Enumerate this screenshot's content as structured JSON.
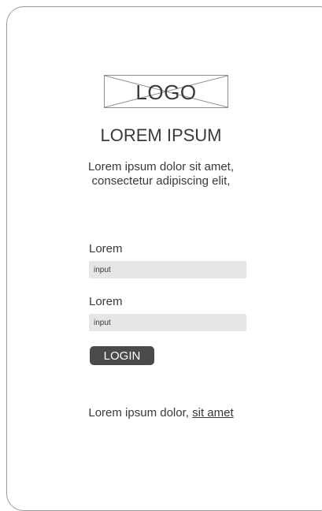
{
  "logo": {
    "text": "LOGO"
  },
  "header": {
    "title": "LOREM IPSUM",
    "subtitle_line1": "Lorem ipsum dolor sit amet,",
    "subtitle_line2": "consectetur adipiscing elit,"
  },
  "form": {
    "field1": {
      "label": "Lorem",
      "placeholder": "input"
    },
    "field2": {
      "label": "Lorem",
      "placeholder": "input"
    },
    "login_label": "LOGIN"
  },
  "footer": {
    "text": "Lorem ipsum dolor,",
    "link": "sit amet"
  },
  "colors": {
    "button_bg": "#4a4a4a",
    "input_bg": "#e6e6e6",
    "text": "#3a3a3a"
  }
}
